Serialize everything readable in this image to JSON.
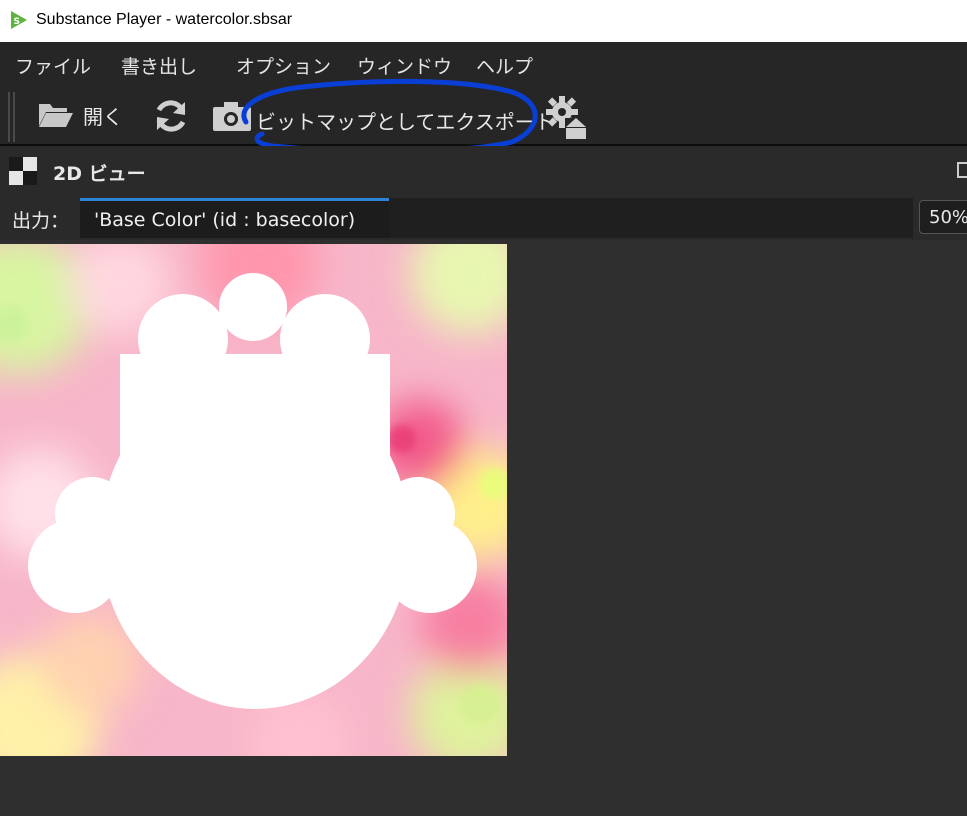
{
  "window": {
    "title": "Substance Player - watercolor.sbsar",
    "icon": "substance-player-logo-icon"
  },
  "menubar": {
    "items": [
      {
        "label": "ファイル"
      },
      {
        "label": "書き出し"
      },
      {
        "label": "オプション"
      },
      {
        "label": "ウィンドウ"
      },
      {
        "label": "ヘルプ"
      }
    ]
  },
  "toolbar": {
    "open_label": "開く",
    "export_bitmap_label": "ビットマップとしてエクスポート",
    "icons": [
      "folder-open-icon",
      "refresh-icon",
      "camera-icon",
      "settings-export-icon"
    ]
  },
  "panel": {
    "title": "2D ビュー",
    "icon": "checker-icon"
  },
  "output": {
    "label": "出力：",
    "selected": "'Base Color' (id : basecolor)",
    "zoom": "50%"
  },
  "colors": {
    "accent": "#2d84d6",
    "annotation": "#0a3fd6",
    "background": "#2f2f2f",
    "bar": "#262626"
  }
}
